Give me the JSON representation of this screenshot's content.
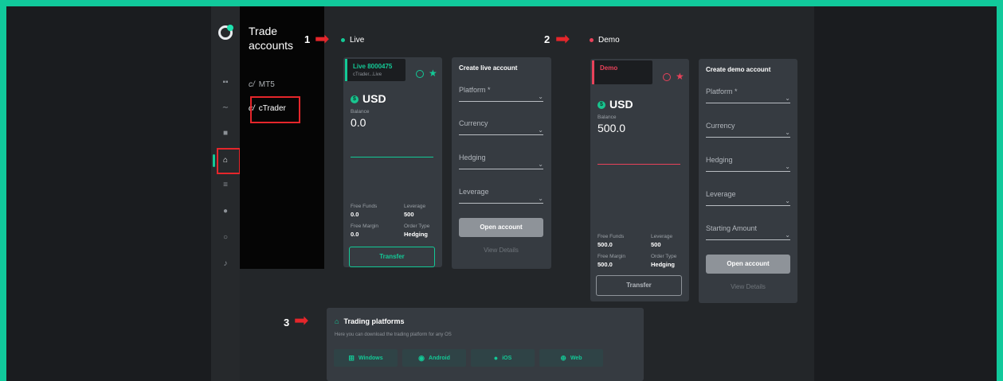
{
  "sidebar": {
    "title": "Trade accounts",
    "items": [
      {
        "prefix": "c/",
        "label": "MT5"
      },
      {
        "prefix": "c/",
        "label": "cTrader"
      }
    ]
  },
  "callouts": {
    "one": "1",
    "two": "2",
    "three": "3"
  },
  "sections": {
    "live": "Live",
    "demo": "Demo"
  },
  "live_account": {
    "tag": "Live 8000475",
    "sub": "cTrader...Live",
    "currency": "USD",
    "coin": "$",
    "balance_label": "Balance",
    "balance": "0.0",
    "free_funds_label": "Free Funds",
    "free_funds": "0.0",
    "leverage_label": "Leverage",
    "leverage": "500",
    "free_margin_label": "Free Margin",
    "free_margin": "0.0",
    "order_type_label": "Order Type",
    "order_type": "Hedging",
    "transfer": "Transfer"
  },
  "create_live": {
    "title": "Create live account",
    "fields": [
      "Platform *",
      "Currency",
      "Hedging",
      "Leverage"
    ],
    "open": "Open account",
    "details": "View Details"
  },
  "demo_account": {
    "tag": "Demo",
    "currency": "USD",
    "coin": "$",
    "balance_label": "Balance",
    "balance": "500.0",
    "free_funds_label": "Free Funds",
    "free_funds": "500.0",
    "leverage_label": "Leverage",
    "leverage": "500",
    "free_margin_label": "Free Margin",
    "free_margin": "500.0",
    "order_type_label": "Order Type",
    "order_type": "Hedging",
    "transfer": "Transfer"
  },
  "create_demo": {
    "title": "Create demo account",
    "fields": [
      "Platform *",
      "Currency",
      "Hedging",
      "Leverage",
      "Starting Amount"
    ],
    "open": "Open account",
    "details": "View Details"
  },
  "platforms": {
    "title": "Trading platforms",
    "subtitle": "Here you can download the trading platform for any OS",
    "buttons": [
      "Windows",
      "Android",
      "iOS",
      "Web"
    ]
  },
  "colors": {
    "accent": "#13c996",
    "live": "#13c996",
    "demo": "#e8425a",
    "annotation": "#e5262b"
  }
}
